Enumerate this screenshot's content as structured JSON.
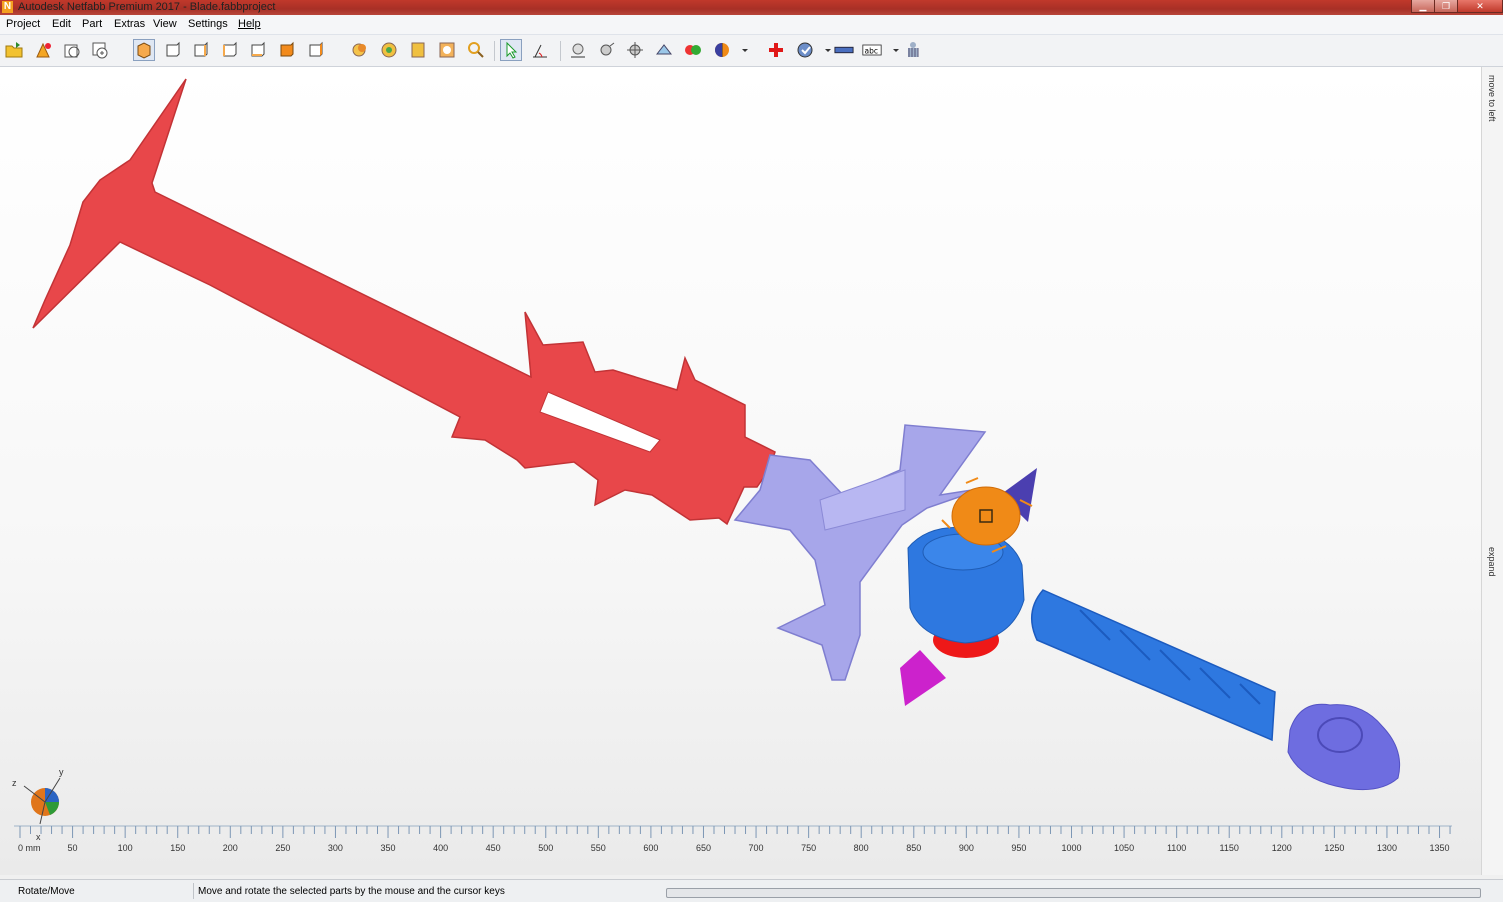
{
  "window": {
    "title": "Autodesk Netfabb Premium 2017 - Blade.fabbproject",
    "app_icon": "N"
  },
  "menu": [
    "Project",
    "Edit",
    "Part",
    "Extras",
    "View",
    "Settings",
    "Help"
  ],
  "side_panel": {
    "top_label": "move to left",
    "bottom_label": "expand"
  },
  "axis_gizmo": {
    "x": "x",
    "y": "y",
    "z": "z"
  },
  "ruler": {
    "unit_label": "0 mm",
    "ticks": [
      "50",
      "100",
      "150",
      "200",
      "250",
      "300",
      "350",
      "400",
      "450",
      "500",
      "550",
      "600",
      "650",
      "700",
      "750",
      "800",
      "850",
      "900",
      "950",
      "1000",
      "1050",
      "1100",
      "1150",
      "1200",
      "1250",
      "1300",
      "1350"
    ]
  },
  "status": {
    "mode": "Rotate/Move",
    "hint": "Move and rotate the selected parts by the mouse and the cursor keys"
  },
  "colors": {
    "blade": "#e8474a",
    "guard": "#a7a6ea",
    "grip": "#2e78e0",
    "accent_orange": "#f08a17",
    "title_bar": "#b03a2e"
  }
}
